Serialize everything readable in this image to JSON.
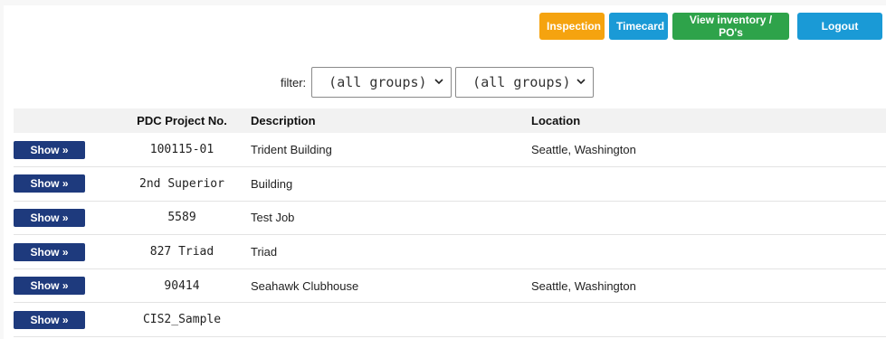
{
  "header": {
    "buttons": {
      "inspection": "Inspection",
      "timecard": "Timecard",
      "inventory": "View inventory / PO's",
      "logout": "Logout"
    },
    "colors": {
      "inspection": "#f5a30f",
      "timecard": "#1a9ad6",
      "inventory": "#2ea34a",
      "logout": "#1a9ad6"
    }
  },
  "filter": {
    "label": "filter:",
    "select1_value": "(all groups)",
    "select2_value": "(all groups)"
  },
  "table": {
    "columns": {
      "project": "PDC Project No.",
      "description": "Description",
      "location": "Location"
    },
    "show_label": "Show »",
    "rows": [
      {
        "project": "100115-01",
        "description": "Trident Building",
        "location": "Seattle, Washington"
      },
      {
        "project": "2nd Superior",
        "description": "Building",
        "location": ""
      },
      {
        "project": "5589",
        "description": "Test Job",
        "location": ""
      },
      {
        "project": "827 Triad",
        "description": "Triad",
        "location": ""
      },
      {
        "project": "90414",
        "description": "Seahawk Clubhouse",
        "location": "Seattle, Washington"
      },
      {
        "project": "CIS2_Sample",
        "description": "",
        "location": ""
      }
    ]
  }
}
